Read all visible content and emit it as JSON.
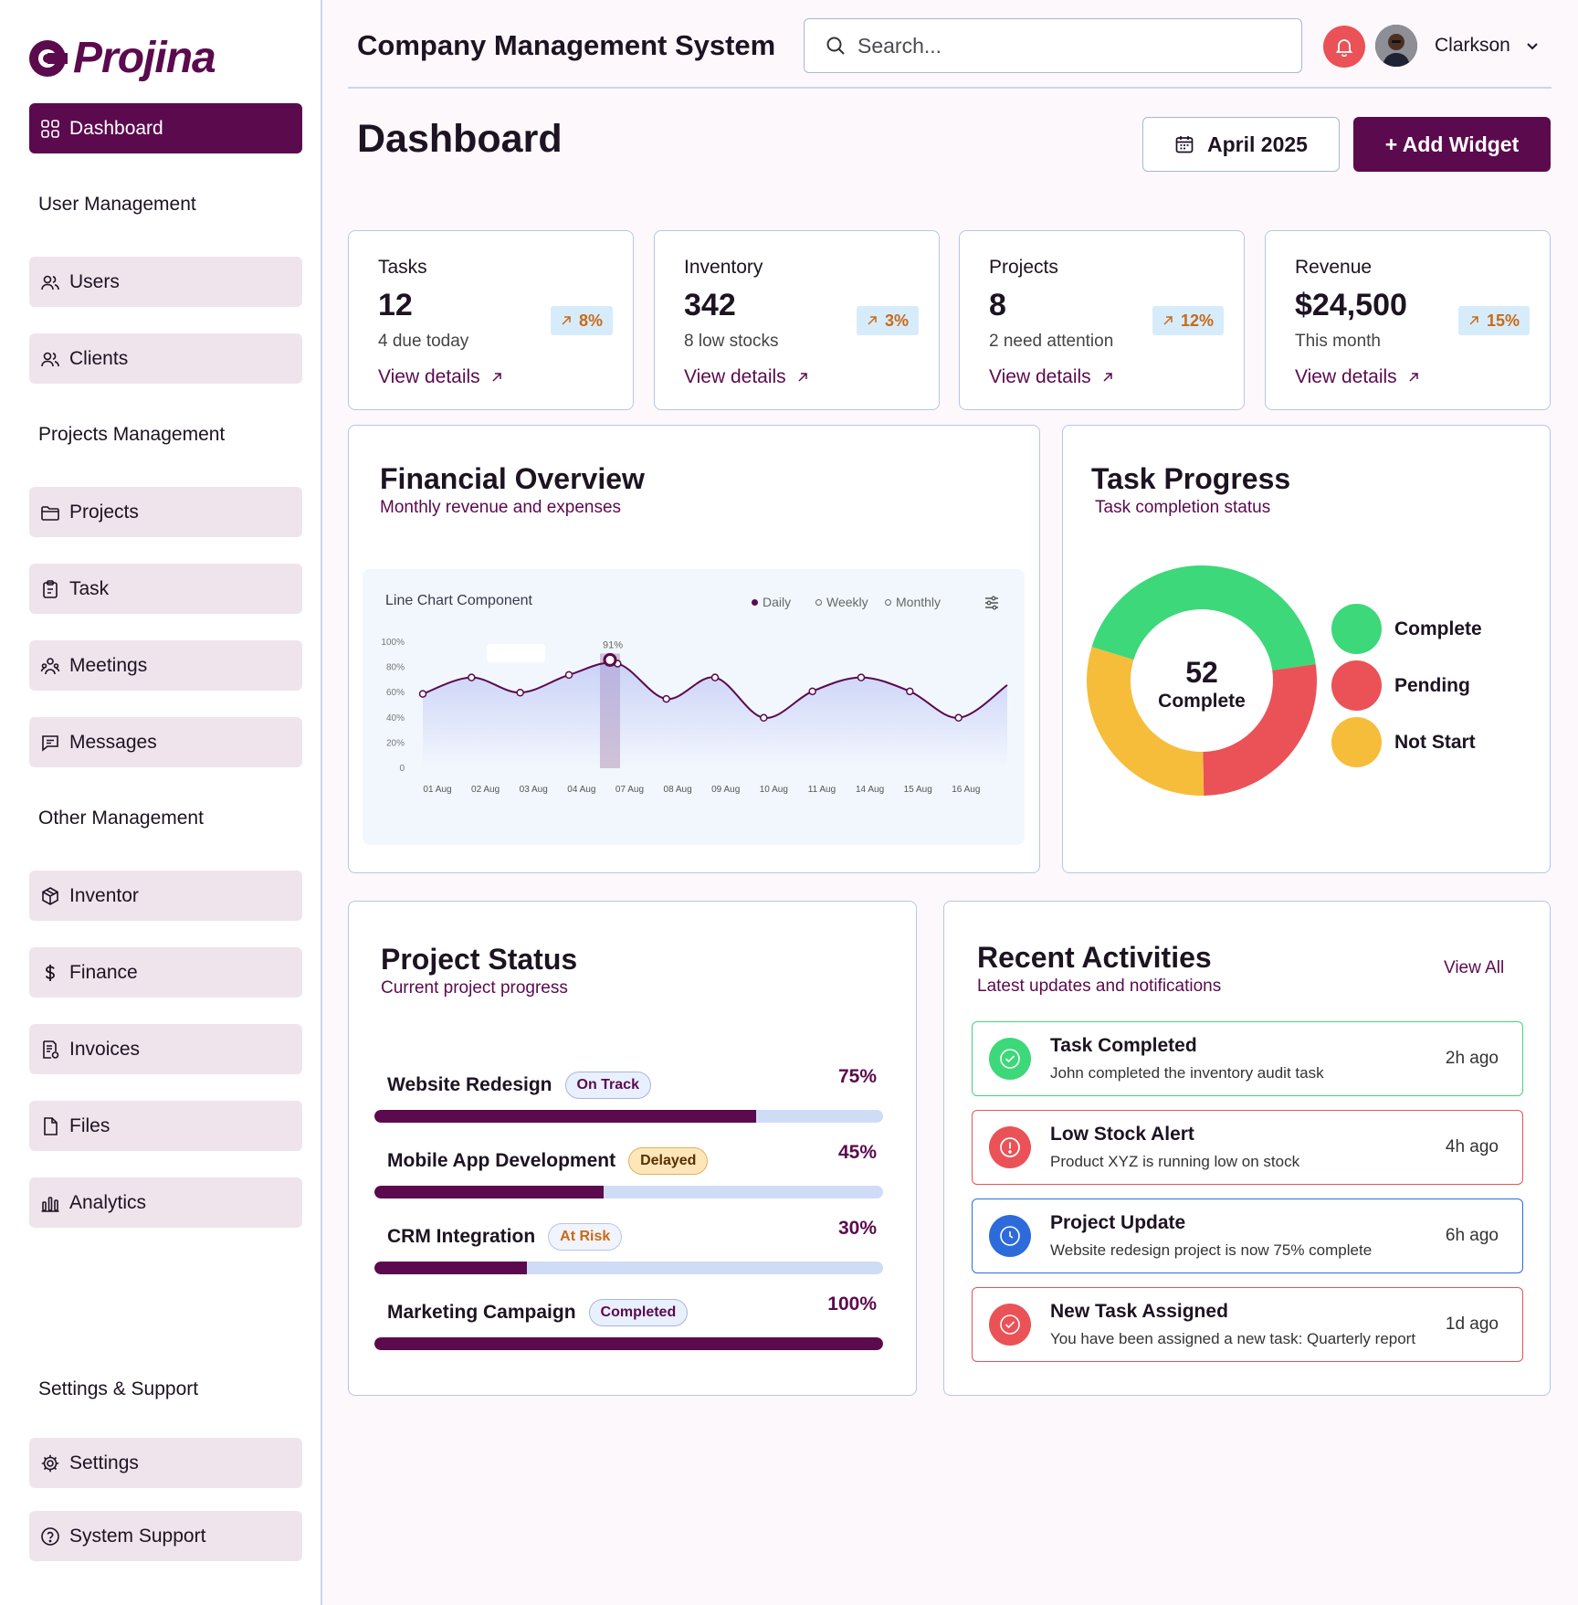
{
  "brand": {
    "name": "Projina"
  },
  "sidebar": {
    "dashboard": "Dashboard",
    "sections": {
      "user_mgmt": "User Management",
      "projects_mgmt": "Projects Management",
      "other_mgmt": "Other Management",
      "settings_support": "Settings & Support"
    },
    "items": {
      "users": "Users",
      "clients": "Clients",
      "projects": "Projects",
      "task": "Task",
      "meetings": "Meetings",
      "messages": "Messages",
      "inventor": "Inventor",
      "finance": "Finance",
      "invoices": "Invoices",
      "files": "Files",
      "analytics": "Analytics",
      "settings": "Settings",
      "support": "System Support"
    }
  },
  "header": {
    "app_title": "Company Management System",
    "search_placeholder": "Search...",
    "user_name": "Clarkson"
  },
  "page": {
    "title": "Dashboard",
    "date_label": "April 2025",
    "add_widget": "+ Add Widget"
  },
  "stats": [
    {
      "label": "Tasks",
      "value": "12",
      "sub": "4 due today",
      "change": "8%",
      "link": "View details"
    },
    {
      "label": "Inventory",
      "value": "342",
      "sub": "8 low stocks",
      "change": "3%",
      "link": "View details"
    },
    {
      "label": "Projects",
      "value": "8",
      "sub": "2 need attention",
      "change": "12%",
      "link": "View details"
    },
    {
      "label": "Revenue",
      "value": "$24,500",
      "sub": "This month",
      "change": "15%",
      "link": "View details"
    }
  ],
  "financial": {
    "title": "Financial Overview",
    "subtitle": "Monthly revenue and expenses",
    "chart_label": "Line Chart Component",
    "legend": {
      "daily": "Daily",
      "weekly": "Weekly",
      "monthly": "Monthly"
    },
    "highlight_label": "91%"
  },
  "task_progress": {
    "title": "Task Progress",
    "subtitle": "Task completion status",
    "center_value": "52",
    "center_label": "Complete",
    "legend": {
      "complete": "Complete",
      "pending": "Pending",
      "not_start": "Not Start"
    }
  },
  "project_status": {
    "title": "Project Status",
    "subtitle": "Current project progress",
    "rows": [
      {
        "name": "Website Redesign",
        "badge": "On Track",
        "pct_label": "75%",
        "pct": 0.75
      },
      {
        "name": "Mobile App Development",
        "badge": "Delayed",
        "pct_label": "45%",
        "pct": 0.45
      },
      {
        "name": "CRM Integration",
        "badge": "At Risk",
        "pct_label": "30%",
        "pct": 0.3
      },
      {
        "name": "Marketing Campaign",
        "badge": "Completed",
        "pct_label": "100%",
        "pct": 1.0
      }
    ]
  },
  "activities": {
    "title": "Recent Activities",
    "subtitle": "Latest updates and notifications",
    "view_all": "View All",
    "items": [
      {
        "title": "Task Completed",
        "desc": "John completed the inventory audit task",
        "time": "2h ago"
      },
      {
        "title": "Low Stock Alert",
        "desc": "Product XYZ is running low on stock",
        "time": "4h ago"
      },
      {
        "title": "Project Update",
        "desc": "Website redesign project is now 75% complete",
        "time": "6h ago"
      },
      {
        "title": "New Task Assigned",
        "desc": "You have been assigned a new task: Quarterly report",
        "time": "1d ago"
      }
    ]
  },
  "colors": {
    "brand": "#5b0a4e",
    "complete": "#3dd879",
    "pending": "#ea5257",
    "not_start": "#f6bd3b",
    "info": "#2d6bdb"
  },
  "chart_data": [
    {
      "type": "line",
      "x": [
        "01 Aug",
        "02 Aug",
        "03 Aug",
        "04 Aug",
        "07 Aug",
        "08 Aug",
        "09 Aug",
        "10 Aug",
        "11 Aug",
        "14 Aug",
        "15 Aug",
        "16 Aug"
      ],
      "y_ticks": [
        "0",
        "20%",
        "40%",
        "60%",
        "80%",
        "100%"
      ],
      "ylim": [
        0,
        100
      ],
      "series": [
        {
          "values": [
            59,
            72,
            60,
            74,
            83,
            55,
            72,
            40,
            61,
            72,
            61,
            40,
            66
          ]
        }
      ],
      "highlight": {
        "value": 91
      }
    },
    {
      "type": "pie",
      "categories": [
        "Complete",
        "Pending",
        "Not Start"
      ],
      "values": [
        43,
        27,
        30
      ]
    }
  ]
}
